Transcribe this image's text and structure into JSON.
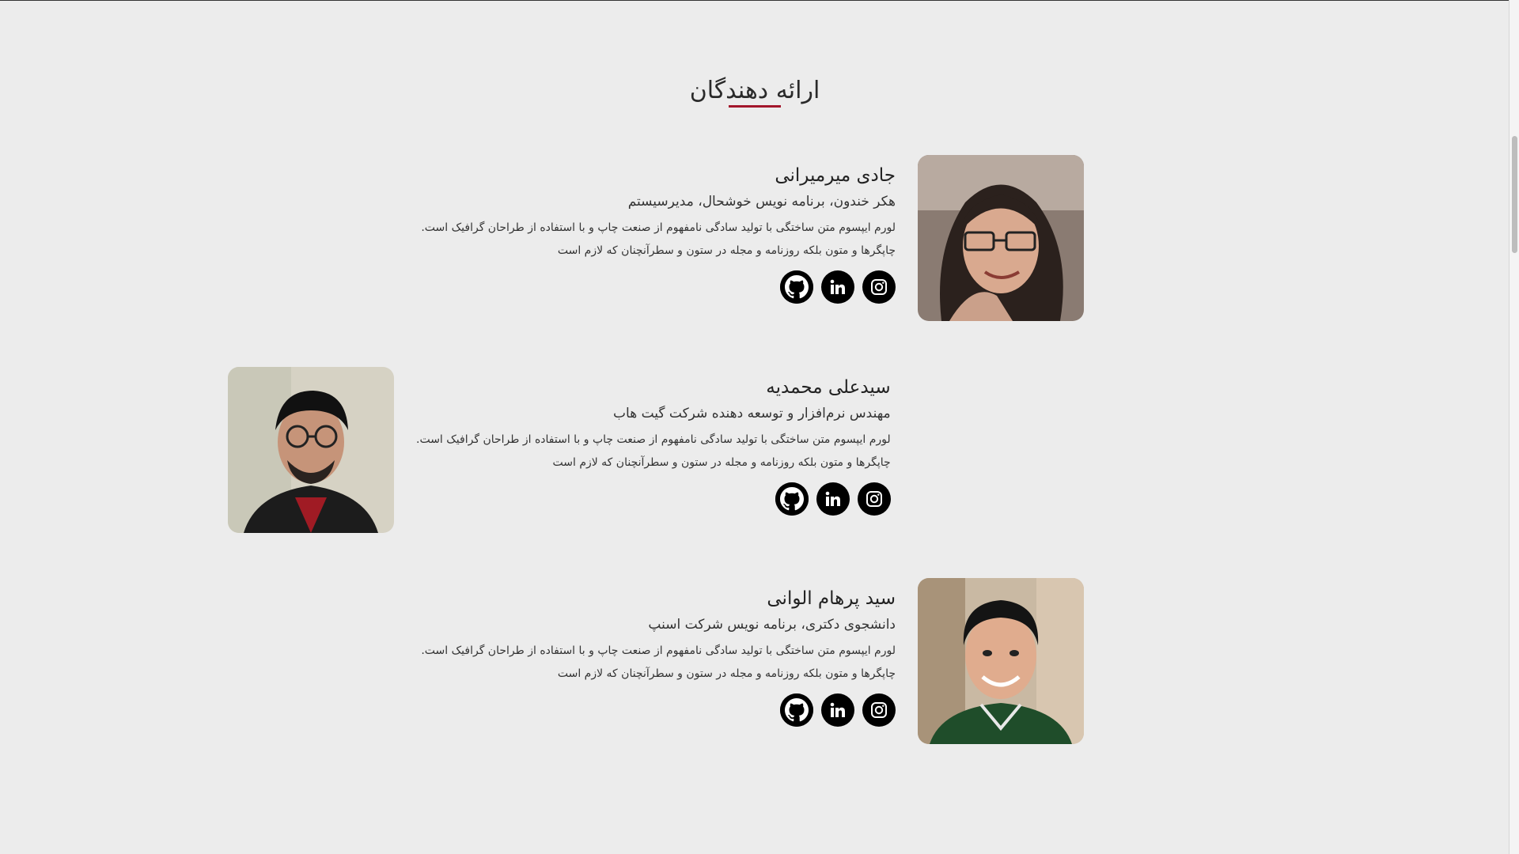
{
  "section": {
    "title": "ارائه دهندگان",
    "accent_color": "#a3162b"
  },
  "presenters": [
    {
      "name": "جادی میرمیرانی",
      "role": "هکر خندون، برنامه نویس خوشحال، مدیرسیستم",
      "desc_line1": "لورم ایپسوم متن ساختگی با تولید سادگی نامفهوم از صنعت چاپ و با استفاده از طراحان گرافیک است.",
      "desc_line2": "چاپگرها و متون بلکه روزنامه و مجله در ستون و سطرآنچنان که لازم است",
      "socials": [
        "instagram-icon",
        "linkedin-icon",
        "github-icon"
      ]
    },
    {
      "name": "سیدعلی محمدیه",
      "role": "مهندس نرم‌افزار و توسعه دهنده شرکت گیت هاب",
      "desc_line1": "لورم ایپسوم متن ساختگی با تولید سادگی نامفهوم از صنعت چاپ و با استفاده از طراحان گرافیک است.",
      "desc_line2": "چاپگرها و متون بلکه روزنامه و مجله در ستون و سطرآنچنان که لازم است",
      "socials": [
        "instagram-icon",
        "linkedin-icon",
        "github-icon"
      ]
    },
    {
      "name": "سید پرهام الوانی",
      "role": "دانشجوی دکتری، برنامه نویس شرکت اسنپ",
      "desc_line1": "لورم ایپسوم متن ساختگی با تولید سادگی نامفهوم از صنعت چاپ و با استفاده از طراحان گرافیک است.",
      "desc_line2": "چاپگرها و متون بلکه روزنامه و مجله در ستون و سطرآنچنان که لازم است",
      "socials": [
        "instagram-icon",
        "linkedin-icon",
        "github-icon"
      ]
    }
  ]
}
